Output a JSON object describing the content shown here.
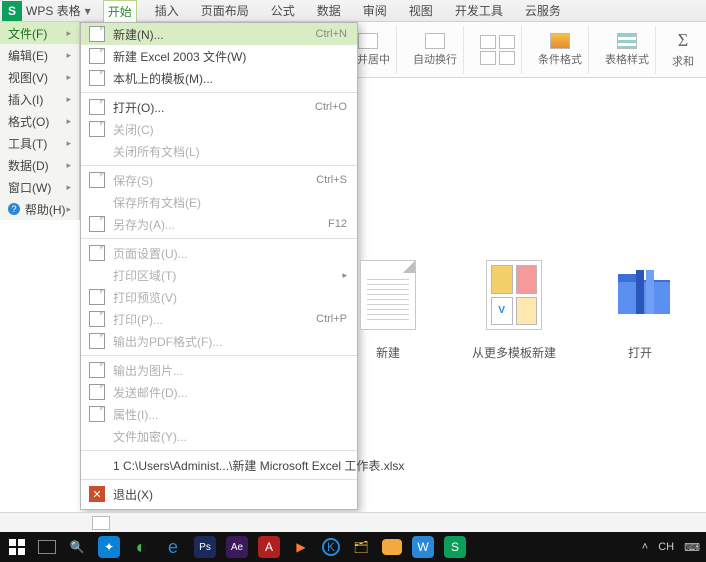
{
  "app": {
    "logo_letter": "S",
    "name": "WPS 表格",
    "caret": "▾"
  },
  "tabs": [
    "开始",
    "插入",
    "页面布局",
    "公式",
    "数据",
    "审阅",
    "视图",
    "开发工具",
    "云服务"
  ],
  "active_tab_index": 0,
  "ribbon": {
    "merge_center": "合并居中",
    "auto_wrap": "自动换行",
    "cond_format": "条件格式",
    "table_style": "表格样式",
    "sum": "求和"
  },
  "left_menu": [
    {
      "label": "文件(F)",
      "active": true
    },
    {
      "label": "编辑(E)"
    },
    {
      "label": "视图(V)"
    },
    {
      "label": "插入(I)"
    },
    {
      "label": "格式(O)"
    },
    {
      "label": "工具(T)"
    },
    {
      "label": "数据(D)"
    },
    {
      "label": "窗口(W)"
    },
    {
      "label": "帮助(H)",
      "help": true
    }
  ],
  "file_menu": [
    {
      "icon": "page",
      "label": "新建(N)...",
      "shortcut": "Ctrl+N",
      "highlight": true
    },
    {
      "icon": "page",
      "label": "新建 Excel 2003 文件(W)"
    },
    {
      "icon": "page",
      "label": "本机上的模板(M)..."
    },
    {
      "sep": true
    },
    {
      "icon": "folder",
      "label": "打开(O)...",
      "shortcut": "Ctrl+O"
    },
    {
      "icon": "page",
      "label": "关闭(C)",
      "disabled": true
    },
    {
      "icon": "",
      "label": "关闭所有文档(L)",
      "disabled": true
    },
    {
      "sep": true
    },
    {
      "icon": "disk",
      "label": "保存(S)",
      "shortcut": "Ctrl+S",
      "disabled": true
    },
    {
      "icon": "",
      "label": "保存所有文档(E)",
      "disabled": true
    },
    {
      "icon": "page",
      "label": "另存为(A)...",
      "shortcut": "F12",
      "disabled": true
    },
    {
      "sep": true
    },
    {
      "icon": "page",
      "label": "页面设置(U)...",
      "disabled": true
    },
    {
      "icon": "",
      "label": "打印区域(T)",
      "sub": true,
      "disabled": true
    },
    {
      "icon": "page",
      "label": "打印预览(V)",
      "disabled": true
    },
    {
      "icon": "print",
      "label": "打印(P)...",
      "shortcut": "Ctrl+P",
      "disabled": true
    },
    {
      "icon": "page",
      "label": "输出为PDF格式(F)...",
      "disabled": true
    },
    {
      "sep": true
    },
    {
      "icon": "page",
      "label": "输出为图片...",
      "disabled": true
    },
    {
      "icon": "mail",
      "label": "发送邮件(D)...",
      "disabled": true
    },
    {
      "icon": "page",
      "label": "属性(I)...",
      "disabled": true
    },
    {
      "icon": "",
      "label": "文件加密(Y)...",
      "disabled": true
    },
    {
      "sep": true
    },
    {
      "icon": "",
      "label": "1 C:\\Users\\Administ...\\新建 Microsoft Excel 工作表.xlsx"
    },
    {
      "sep": true
    },
    {
      "icon": "box",
      "label": "退出(X)"
    }
  ],
  "tiles": {
    "new": "新建",
    "templates": "从更多模板新建",
    "open": "打开"
  },
  "tray": {
    "ime": "CH"
  }
}
